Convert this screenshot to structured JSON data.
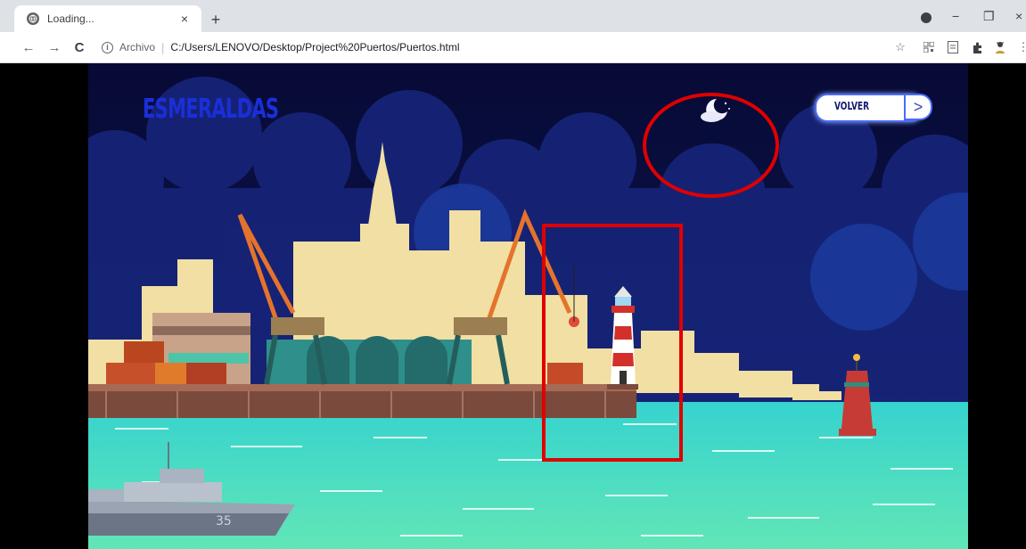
{
  "browser": {
    "tab": {
      "title": "Loading...",
      "close_glyph": "×"
    },
    "new_tab_glyph": "+",
    "nav": {
      "back": "←",
      "forward": "→",
      "reload": "C"
    },
    "address": {
      "scheme_label": "Archivo",
      "separator": "|",
      "url": "C:/Users/LENOVO/Desktop/Project%20Puertos/Puertos.html"
    },
    "window_controls": {
      "minimize": "−",
      "restore": "❐",
      "close": "×"
    },
    "toolbar_icons": [
      "star-icon",
      "qr-code-icon",
      "reading-list-icon",
      "extensions-icon",
      "profile-icon",
      "menu-icon"
    ]
  },
  "page": {
    "city_name": "ESMERALDAS",
    "back_button_label": "VOLVER",
    "back_button_arrow": ">",
    "mode_icon": "moon-cloud-icon",
    "ship_hull_number": "35"
  },
  "colors": {
    "sky": "#0b0f3f",
    "sea": "#3fd6c0",
    "title": "#1a2fd9",
    "annotation": "#e00000",
    "button_border": "#4a6cf7"
  }
}
